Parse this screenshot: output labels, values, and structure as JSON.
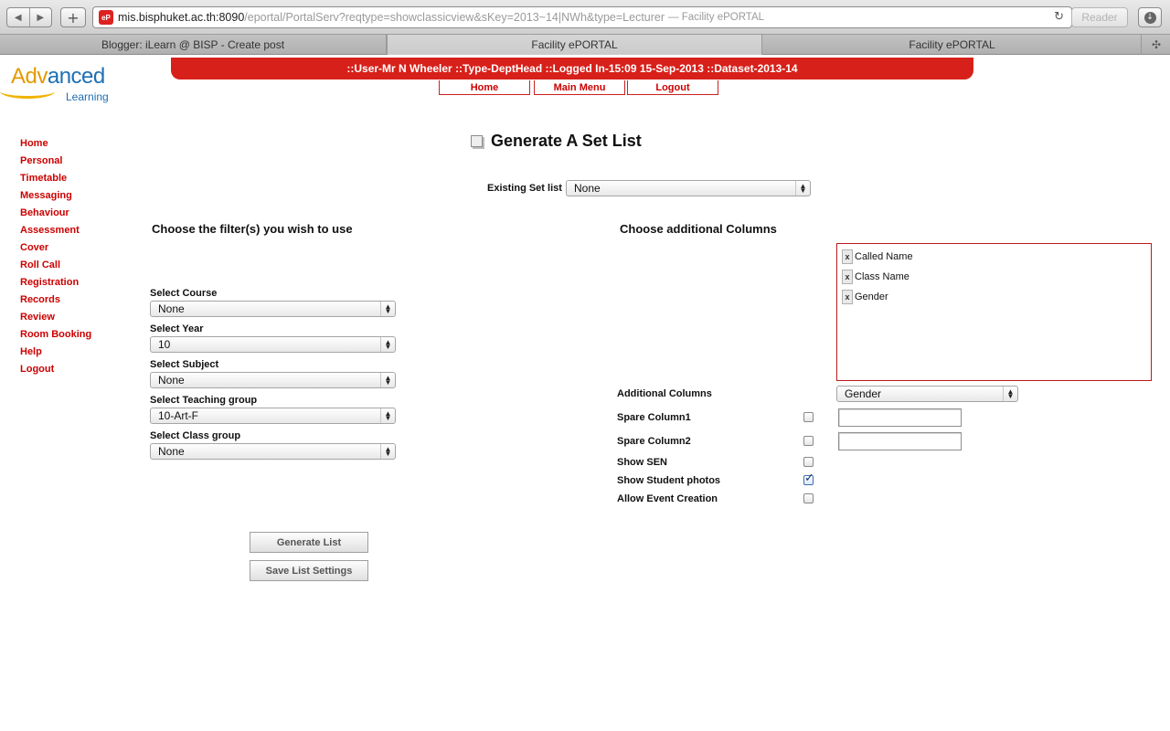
{
  "browser": {
    "url_host": "mis.bisphuket.ac.th:8090",
    "url_rest": "/eportal/PortalServ?reqtype=showclassicview&sKey=2013~14|NWh&type=Lecturer",
    "url_title": "— Facility ePORTAL",
    "reader_label": "Reader",
    "favicon_text": "eP",
    "tabs": [
      {
        "label": "Blogger: iLearn @ BISP - Create post"
      },
      {
        "label": "Facility ePORTAL"
      },
      {
        "label": "Facility ePORTAL"
      }
    ]
  },
  "logo": {
    "part1": "Adv",
    "part2": "anced",
    "sub": "Learning"
  },
  "status_bar": "::User-Mr N Wheeler   ::Type-DeptHead  ::Logged In-15:09 15-Sep-2013   ::Dataset-2013-14",
  "top_nav": {
    "home": "Home",
    "main_menu": "Main Menu",
    "logout": "Logout"
  },
  "sidebar": [
    {
      "label": "Home"
    },
    {
      "label": "Personal"
    },
    {
      "label": "Timetable"
    },
    {
      "label": "Messaging"
    },
    {
      "label": "Behaviour"
    },
    {
      "label": "Assessment"
    },
    {
      "label": "Cover"
    },
    {
      "label": "Roll Call"
    },
    {
      "label": "Registration"
    },
    {
      "label": "Records"
    },
    {
      "label": "Review"
    },
    {
      "label": "Room Booking"
    },
    {
      "label": "Help"
    },
    {
      "label": "Logout"
    }
  ],
  "page": {
    "title": "Generate A Set List",
    "existing_label": "Existing Set list",
    "existing_value": "None",
    "filters_heading": "Choose the filter(s) you wish to use",
    "columns_heading": "Choose additional Columns"
  },
  "filters": {
    "course_label": "Select Course",
    "course_value": "None",
    "year_label": "Select Year",
    "year_value": "10",
    "subject_label": "Select Subject",
    "subject_value": "None",
    "teaching_label": "Select Teaching group",
    "teaching_value": "10-Art-F",
    "class_label": "Select Class group",
    "class_value": "None"
  },
  "buttons": {
    "generate": "Generate List",
    "save": "Save List Settings"
  },
  "columns": {
    "selected": [
      {
        "label": "Called Name"
      },
      {
        "label": "Class Name"
      },
      {
        "label": "Gender"
      }
    ],
    "remove_glyph": "x",
    "additional_label": "Additional Columns",
    "additional_value": "Gender",
    "spare1_label": "Spare Column1",
    "spare2_label": "Spare Column2",
    "sen_label": "Show SEN",
    "photos_label": "Show Student photos",
    "event_label": "Allow Event Creation",
    "spare1_checked": false,
    "spare2_checked": false,
    "sen_checked": false,
    "photos_checked": true,
    "event_checked": false
  }
}
